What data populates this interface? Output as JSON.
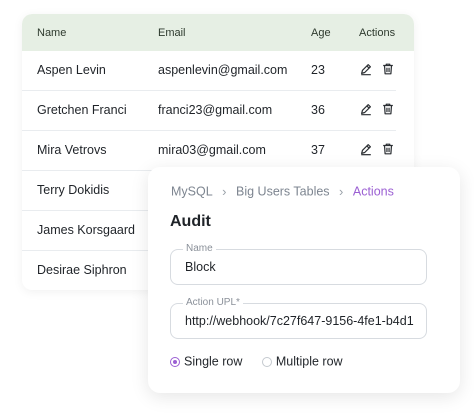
{
  "table": {
    "headers": {
      "name": "Name",
      "email": "Email",
      "age": "Age",
      "actions": "Actions"
    },
    "rows": [
      {
        "name": "Aspen Levin",
        "email": "aspenlevin@gmail.com",
        "age": "23"
      },
      {
        "name": "Gretchen Franci",
        "email": "franci23@gmail.com",
        "age": "36"
      },
      {
        "name": "Mira Vetrovs",
        "email": "mira03@gmail.com",
        "age": "37"
      },
      {
        "name": "Terry Dokidis",
        "email": "",
        "age": ""
      },
      {
        "name": "James Korsgaard",
        "email": "",
        "age": ""
      },
      {
        "name": "Desirae Siphron",
        "email": "",
        "age": ""
      }
    ],
    "action_icons": [
      "edit-icon",
      "trash-icon"
    ]
  },
  "form": {
    "breadcrumb": [
      "MySQL",
      "Big Users Tables",
      "Actions"
    ],
    "title": "Audit",
    "name_field": {
      "label": "Name",
      "value": "Block"
    },
    "url_field": {
      "label": "Action UPL*",
      "value": "http://webhook/7c27f647-9156-4fe1-b4d1"
    },
    "row_mode": {
      "options": [
        "Single row",
        "Multiple row"
      ],
      "selected": "Single row"
    }
  },
  "colors": {
    "header_bg": "#e6efe4",
    "accent": "#9b5fd3"
  }
}
